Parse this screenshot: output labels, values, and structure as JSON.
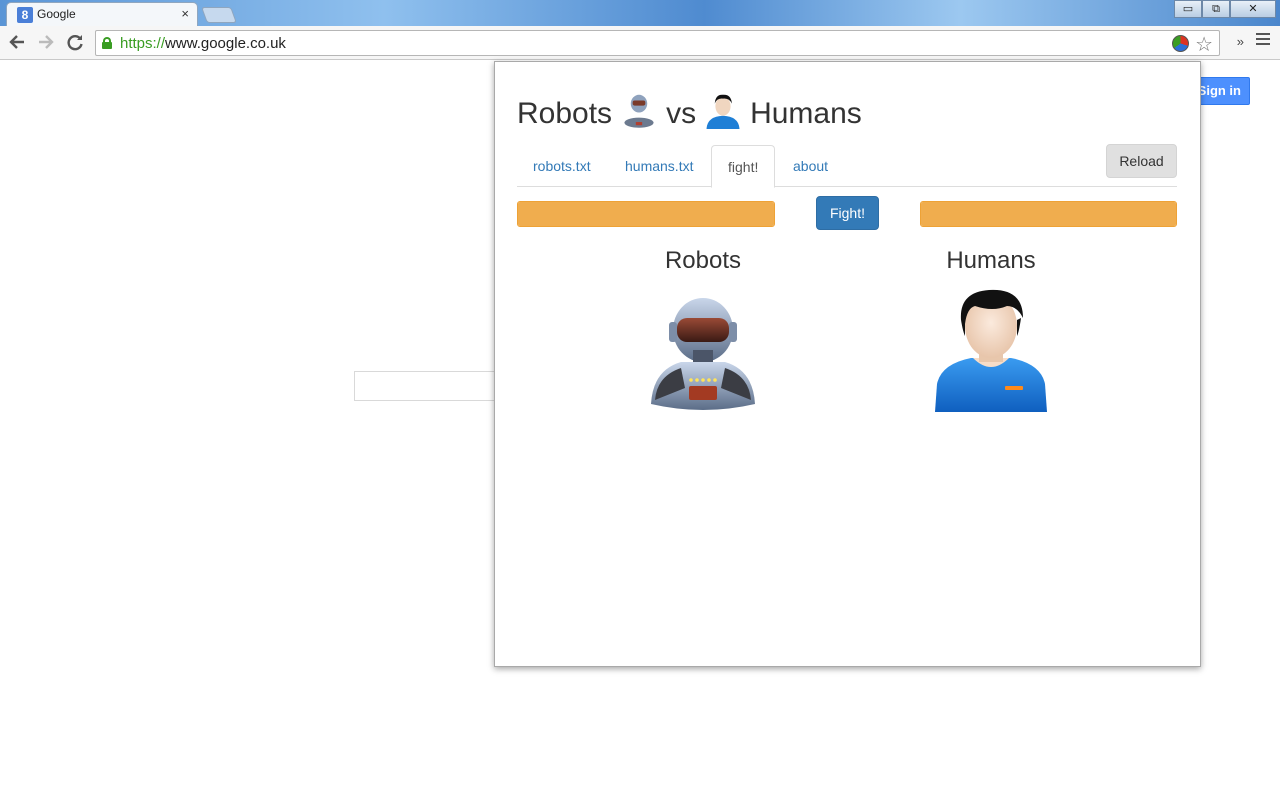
{
  "browser": {
    "tab_title": "Google",
    "tab_favicon": "8",
    "tab_close": "×",
    "url_scheme": "https://",
    "url_host": "www.google.co.uk",
    "window_buttons": [
      "▭",
      "⧉",
      "✕"
    ],
    "overflow_chevron": "»"
  },
  "page": {
    "signin_label": "Sign in"
  },
  "popup": {
    "title_left": "Robots",
    "title_mid": "vs",
    "title_right": "Humans",
    "tabs": [
      {
        "label": "robots.txt",
        "active": false
      },
      {
        "label": "humans.txt",
        "active": false
      },
      {
        "label": "fight!",
        "active": true
      },
      {
        "label": "about",
        "active": false
      }
    ],
    "reload_label": "Reload",
    "fight_label": "Fight!",
    "robots_health": 1.0,
    "humans_health": 1.0,
    "robots_label": "Robots",
    "humans_label": "Humans",
    "bar_color": "#f0ad4e",
    "fight_color": "#337ab7"
  },
  "icons": [
    "back-arrow-icon",
    "forward-arrow-icon",
    "reload-icon",
    "lock-icon",
    "extension-icon",
    "star-icon",
    "menu-icon",
    "robot-icon",
    "human-icon"
  ]
}
